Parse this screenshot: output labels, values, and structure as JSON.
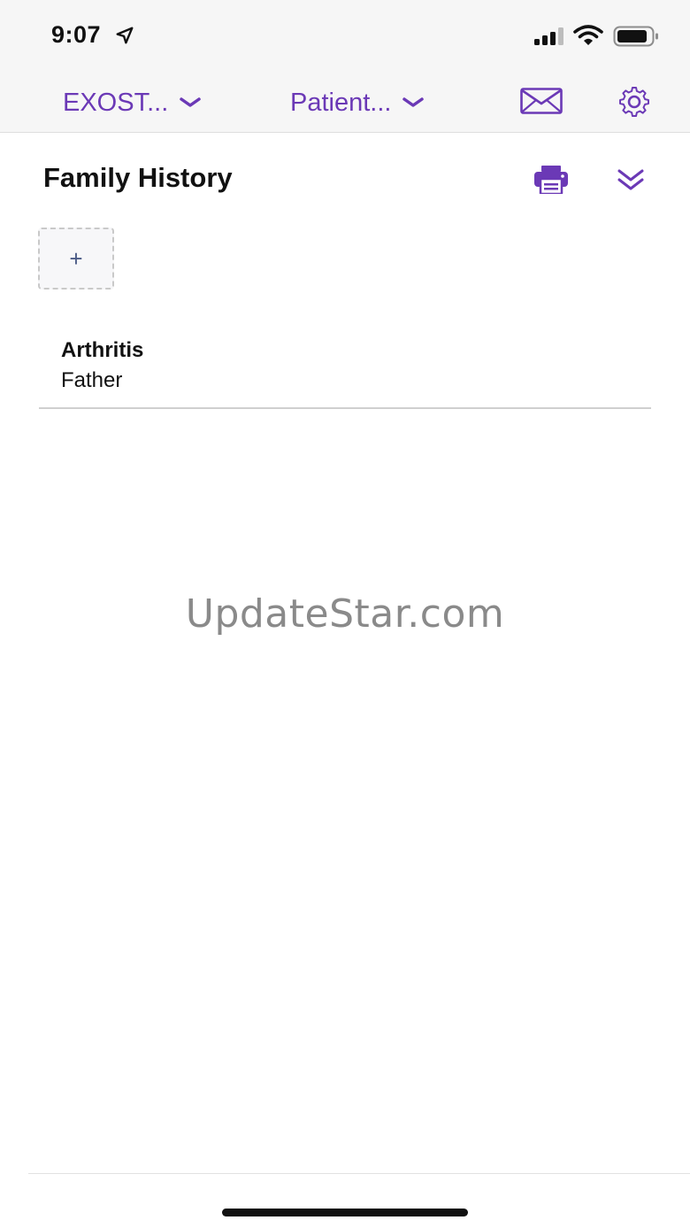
{
  "status_bar": {
    "time": "9:07"
  },
  "nav": {
    "practice_label": "EXOST...",
    "patient_label": "Patient..."
  },
  "section": {
    "title": "Family History",
    "add_label": "+"
  },
  "history": [
    {
      "condition": "Arthritis",
      "relation": "Father"
    }
  ],
  "watermark": "UpdateStar.com",
  "colors": {
    "accent": "#6b39b6",
    "header_bg": "#f6f6f6",
    "add_icon": "#4a5a86"
  },
  "icons": {
    "location": "location-arrow-icon",
    "signal": "cellular-signal-icon",
    "wifi": "wifi-icon",
    "battery": "battery-icon",
    "mail": "mail-icon",
    "settings": "gear-icon",
    "print": "printer-icon",
    "collapse": "double-chevron-down-icon"
  }
}
